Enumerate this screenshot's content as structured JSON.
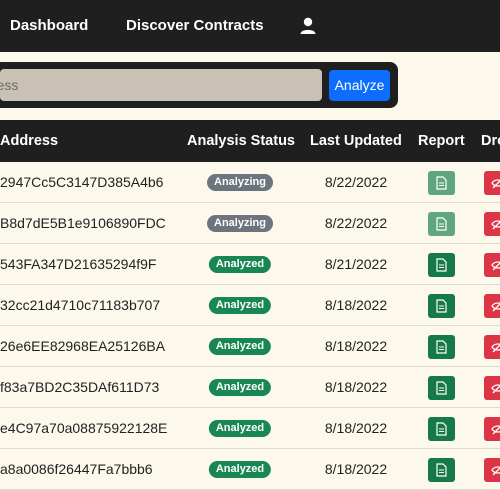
{
  "nav": {
    "dashboard": "Dashboard",
    "discover": "Discover Contracts",
    "user_icon": "user-icon"
  },
  "search": {
    "placeholder": "t Address",
    "button": "Analyze"
  },
  "table": {
    "headers": {
      "address": "Address",
      "status": "Analysis Status",
      "updated": "Last Updated",
      "report": "Report",
      "drop": "Dro"
    },
    "rows": [
      {
        "address": "2947Cc5C3147D385A4b6",
        "status": "Analyzing",
        "updated": "8/22/2022"
      },
      {
        "address": "B8d7dE5B1e9106890FDC",
        "status": "Analyzing",
        "updated": "8/22/2022"
      },
      {
        "address": "543FA347D21635294f9F",
        "status": "Analyzed",
        "updated": "8/21/2022"
      },
      {
        "address": "32cc21d4710c71183b707",
        "status": "Analyzed",
        "updated": "8/18/2022"
      },
      {
        "address": "26e6EE82968EA25126BA",
        "status": "Analyzed",
        "updated": "8/18/2022"
      },
      {
        "address": "f83a7BD2C35DAf611D73",
        "status": "Analyzed",
        "updated": "8/18/2022"
      },
      {
        "address": "e4C97a70a08875922128E",
        "status": "Analyzed",
        "updated": "8/18/2022"
      },
      {
        "address": "a8a0086f26447Fa7bbb6",
        "status": "Analyzed",
        "updated": "8/18/2022"
      }
    ]
  },
  "colors": {
    "navbar": "#1f1f1f",
    "background": "#fcf8ec",
    "primary": "#0d6efd",
    "success": "#198754",
    "secondary": "#6c757d",
    "danger": "#dc3545"
  }
}
